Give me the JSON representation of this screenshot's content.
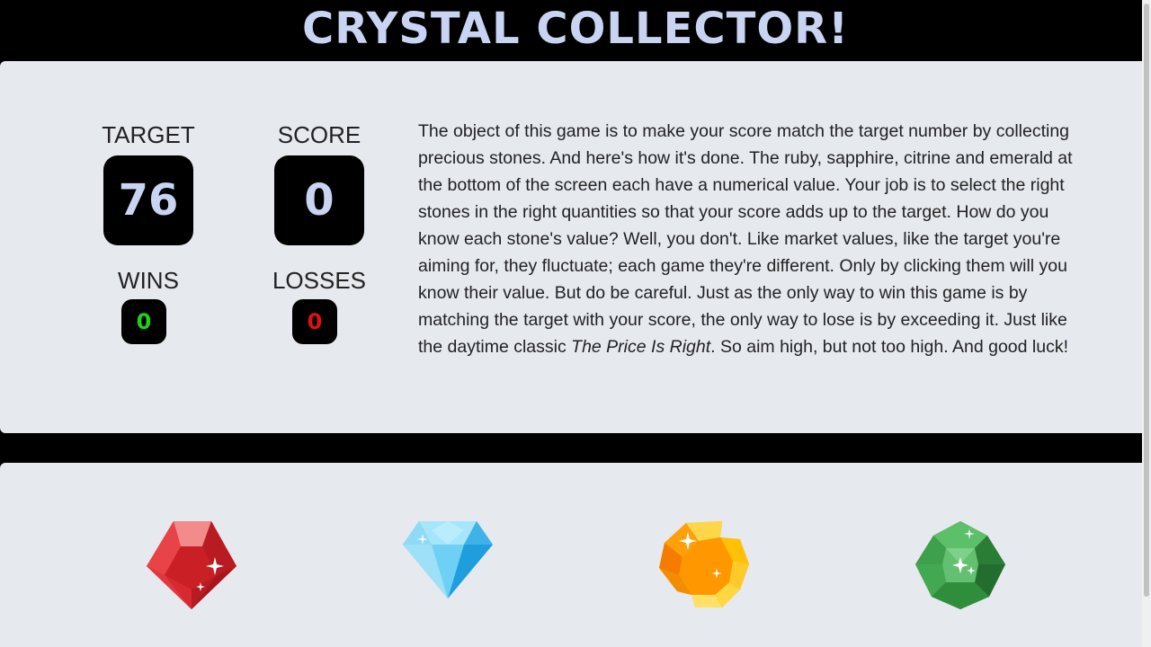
{
  "title": "CRYSTAL COLLECTOR!",
  "stats": {
    "target_label": "TARGET",
    "target_value": "76",
    "score_label": "SCORE",
    "score_value": "0",
    "wins_label": "WINS",
    "wins_value": "0",
    "losses_label": "LOSSES",
    "losses_value": "0"
  },
  "instructions": {
    "before_italic": "The object of this game is to make your score match the target number by collecting precious stones. And here's how it's done. The ruby, sapphire, citrine and emerald at the bottom of the screen each have a numerical value. Your job is to select the right stones in the right quantities so that your score adds up to the target. How do you know each stone's value? Well, you don't. Like market values, like the target you're aiming for, they fluctuate; each game they're different. Only by clicking them will you know their value. But do be careful. Just as the only way to win this game is by matching the target with your score, the only way to lose is by exceeding it. Just like the daytime classic ",
    "italic": "The Price Is Right",
    "after_italic": ". So aim high, but not too high. And good luck!"
  },
  "gems": [
    {
      "name": "ruby",
      "icon": "ruby-icon"
    },
    {
      "name": "sapphire",
      "icon": "sapphire-icon"
    },
    {
      "name": "citrine",
      "icon": "citrine-icon"
    },
    {
      "name": "emerald",
      "icon": "emerald-icon"
    }
  ],
  "colors": {
    "title": "#c9d3f2",
    "panel": "#e6e9ee",
    "wins": "#1fd11f",
    "losses": "#e01010"
  }
}
